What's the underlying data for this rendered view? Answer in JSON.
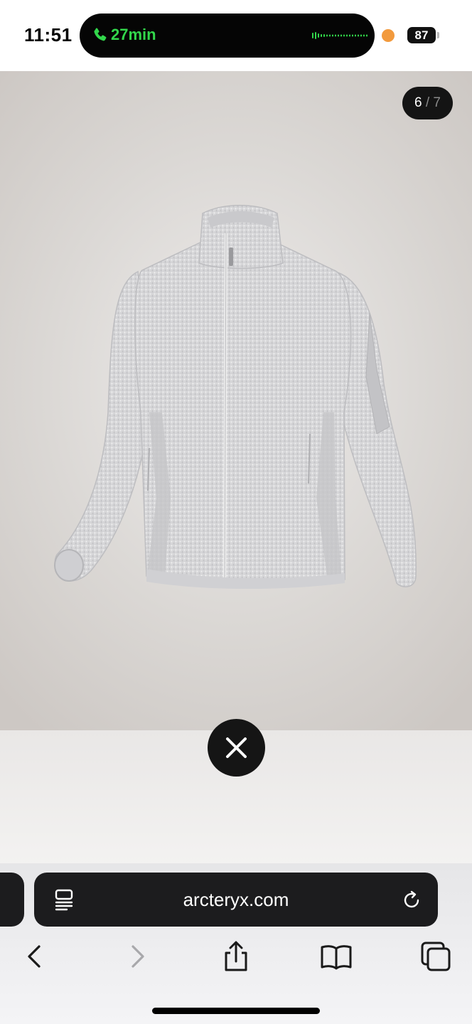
{
  "status_bar": {
    "time": "11:51",
    "call_duration": "27min",
    "battery": "87",
    "colors": {
      "call_green": "#32d74b",
      "recording_dot": "#f29a3d"
    }
  },
  "gallery": {
    "current": "6",
    "separator": "/",
    "total": "7",
    "product_image": "light grey knit fleece zip jacket"
  },
  "browser": {
    "url": "arcteryx.com",
    "icons": [
      "reader-icon",
      "reload-icon",
      "back-icon",
      "forward-icon",
      "share-icon",
      "bookmarks-icon",
      "tabs-icon",
      "close-icon"
    ]
  }
}
